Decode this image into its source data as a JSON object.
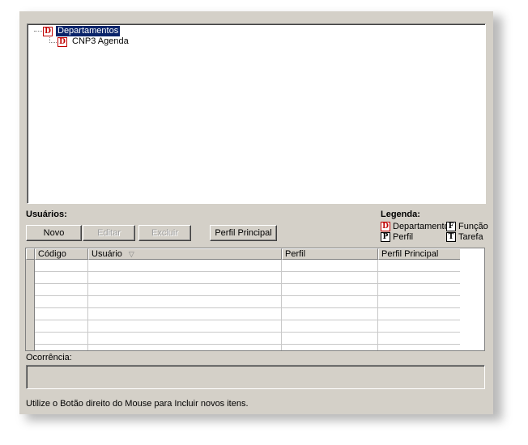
{
  "tree": {
    "root": {
      "icon": "D",
      "label": "Departamentos"
    },
    "child": {
      "icon": "D",
      "label": "CNP3 Agenda"
    }
  },
  "users": {
    "title": "Usuários:",
    "buttons": {
      "new": "Novo",
      "edit": "Editar",
      "delete": "Excluir",
      "main_profile": "Perfil Principal"
    }
  },
  "legend": {
    "title": "Legenda:",
    "items": [
      {
        "icon": "D",
        "label": "Departamento",
        "color": "#c00000"
      },
      {
        "icon": "F",
        "label": "Função",
        "color": "#000000"
      },
      {
        "icon": "P",
        "label": "Perfil",
        "color": "#000000"
      },
      {
        "icon": "T",
        "label": "Tarefa",
        "color": "#000000"
      }
    ]
  },
  "grid": {
    "columns": [
      "Código",
      "Usuário",
      "Perfil",
      "Perfil Principal"
    ],
    "sort_icon": "sort-down-icon"
  },
  "ocorrencia": {
    "label": "Ocorrência:"
  },
  "status": {
    "hint": "Utilize o Botão direito do Mouse para Incluir novos itens."
  },
  "colors": {
    "window_bg": "#d4d0c8",
    "selection": "#0a246a",
    "dept_icon": "#c00000"
  }
}
